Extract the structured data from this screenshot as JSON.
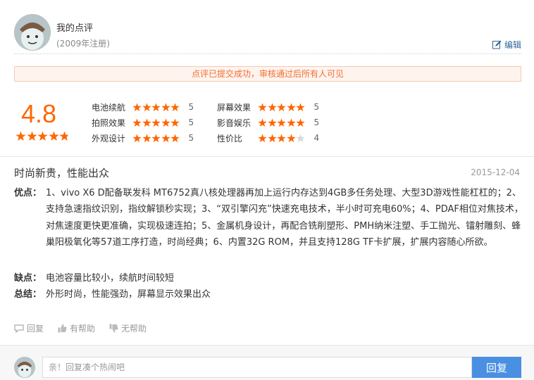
{
  "user": {
    "name": "我的点评",
    "registered": "(2009年注册)",
    "edit_label": "编辑"
  },
  "notice": "点评已提交成功，审核通过后所有人可见",
  "overall": {
    "score": "4.8",
    "stars": 4.8
  },
  "ratings": [
    {
      "label": "电池续航",
      "value": "5",
      "stars": 5
    },
    {
      "label": "拍照效果",
      "value": "5",
      "stars": 5
    },
    {
      "label": "外观设计",
      "value": "5",
      "stars": 5
    },
    {
      "label": "屏幕效果",
      "value": "5",
      "stars": 5
    },
    {
      "label": "影音娱乐",
      "value": "5",
      "stars": 5
    },
    {
      "label": "性价比",
      "value": "4",
      "stars": 4
    }
  ],
  "review": {
    "title": "时尚新贵，性能出众",
    "date": "2015-12-04",
    "pros_label": "优点：",
    "pros": "1、vivo X6 D配备联发科 MT6752真八核处理器再加上运行内存达到4GB多任务处理、大型3D游戏性能杠杠的；2、支持急速指纹识别，指纹解锁秒实现；3、“双引擎闪充”快速充电技术，半小时可充电60%；4、PDAF相位对焦技术，对焦速度更快更准确，实现极速连拍；5、金属机身设计，再配合铣削塑形、PMH纳米注塑、手工抛光、镭射雕刻、蜂巢阳极氧化等57道工序打造，时尚经典；6、内置32G ROM，并且支持128G TF卡扩展，扩展内容随心所欲。",
    "cons_label": "缺点：",
    "cons": "电池容量比较小，续航时间较短",
    "summary_label": "总结：",
    "summary": "外形时尚，性能强劲，屏幕显示效果出众"
  },
  "actions": {
    "reply": "回复",
    "helpful": "有帮助",
    "unhelpful": "无帮助"
  },
  "reply_box": {
    "placeholder": "亲！回复凑个热闹吧",
    "button": "回复"
  },
  "colors": {
    "accent": "#ff6600",
    "star_off": "#d9d9d9",
    "button": "#4a90e2",
    "link": "#336699"
  }
}
